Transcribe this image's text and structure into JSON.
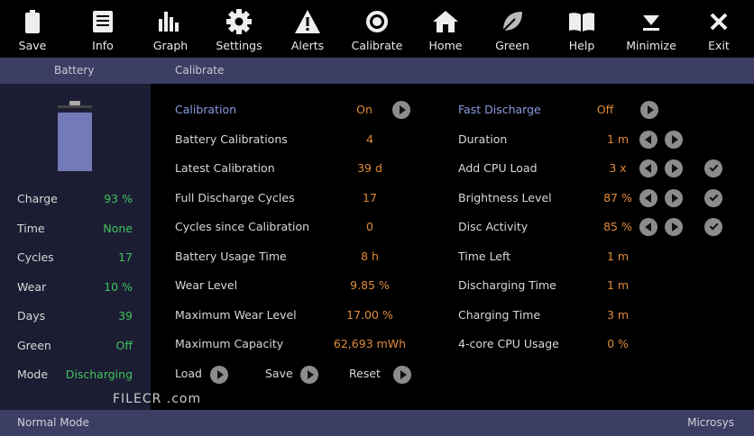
{
  "toolbar": [
    {
      "label": "Save",
      "icon": "battery-icon"
    },
    {
      "label": "Info",
      "icon": "list-icon"
    },
    {
      "label": "Graph",
      "icon": "bar-chart-icon"
    },
    {
      "label": "Settings",
      "icon": "gear-icon"
    },
    {
      "label": "Alerts",
      "icon": "warning-icon"
    },
    {
      "label": "Calibrate",
      "icon": "target-icon"
    },
    {
      "label": "Home",
      "icon": "home-icon"
    },
    {
      "label": "Green",
      "icon": "leaf-icon"
    },
    {
      "label": "Help",
      "icon": "book-icon"
    },
    {
      "label": "Minimize",
      "icon": "minimize-icon"
    },
    {
      "label": "Exit",
      "icon": "close-icon"
    }
  ],
  "tabs": {
    "left": "Battery",
    "main": "Calibrate"
  },
  "stats": [
    {
      "label": "Charge",
      "value": "93 %"
    },
    {
      "label": "Time",
      "value": "None"
    },
    {
      "label": "Cycles",
      "value": "17"
    },
    {
      "label": "Wear",
      "value": "10 %"
    },
    {
      "label": "Days",
      "value": "39"
    },
    {
      "label": "Green",
      "value": "Off"
    },
    {
      "label": "Mode",
      "value": "Discharging"
    }
  ],
  "battery_level_percent": 93,
  "calibrate": [
    {
      "label": "Calibration",
      "value": "On"
    },
    {
      "label": "Battery Calibrations",
      "value": "4"
    },
    {
      "label": "Latest Calibration",
      "value": "39 d"
    },
    {
      "label": "Full Discharge Cycles",
      "value": "17"
    },
    {
      "label": "Cycles since Calibration",
      "value": "0"
    },
    {
      "label": "Battery Usage Time",
      "value": "8 h"
    },
    {
      "label": "Wear Level",
      "value": "9.85 %"
    },
    {
      "label": "Maximum Wear Level",
      "value": "17.00 %"
    },
    {
      "label": "Maximum Capacity",
      "value": "62,693 mWh"
    }
  ],
  "discharge": [
    {
      "label": "Fast Discharge",
      "value": "Off"
    },
    {
      "label": "Duration",
      "value": "1 m"
    },
    {
      "label": "Add CPU Load",
      "value": "3 x"
    },
    {
      "label": "Brightness Level",
      "value": "87 %"
    },
    {
      "label": "Disc Activity",
      "value": "85 %"
    },
    {
      "label": "Time Left",
      "value": "1 m"
    },
    {
      "label": "Discharging Time",
      "value": "1 m"
    },
    {
      "label": "Charging Time",
      "value": "3 m"
    },
    {
      "label": "4-core CPU Usage",
      "value": "0 %"
    }
  ],
  "actions": {
    "load": "Load",
    "save": "Save",
    "reset": "Reset"
  },
  "footer": {
    "mode": "Normal Mode",
    "brand": "Microsys"
  },
  "watermark": "FILECR .com"
}
